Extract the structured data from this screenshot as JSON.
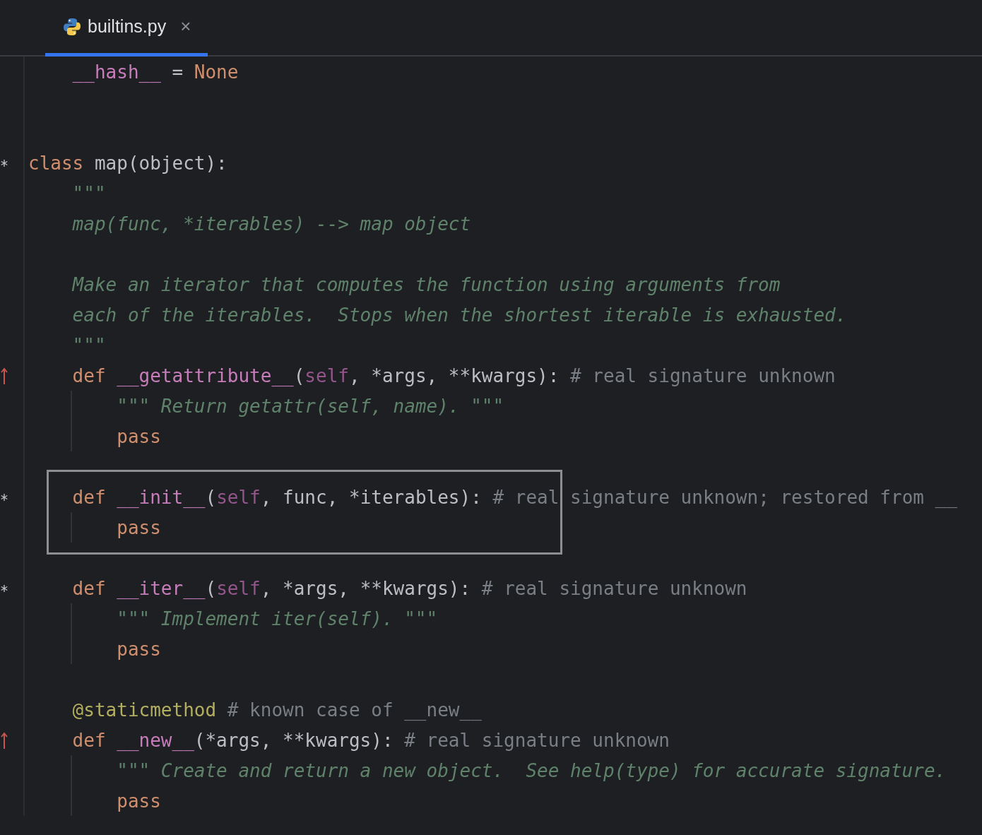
{
  "tabs": [
    {
      "label": "builtins.py",
      "close": "×",
      "selected": true
    }
  ],
  "lines": [
    {
      "kind": "code",
      "guide": false,
      "boxed": false,
      "tokens": [
        {
          "kind": "dunder",
          "text": "    __hash__"
        },
        {
          "kind": "plain",
          "text": " = "
        },
        {
          "kind": "kw",
          "text": "None"
        }
      ]
    },
    {
      "kind": "code",
      "guide": false,
      "boxed": false
    },
    {
      "kind": "code",
      "guide": false,
      "boxed": false
    },
    {
      "kind": "asterisk",
      "guide": false,
      "boxed": false,
      "tokens": [
        {
          "kind": "kw",
          "text": "class"
        },
        {
          "kind": "plain",
          "text": " map(object):"
        }
      ]
    },
    {
      "kind": "code",
      "guide": false,
      "boxed": false,
      "tokens": [
        {
          "kind": "doc",
          "text": "    \"\"\""
        }
      ]
    },
    {
      "kind": "code",
      "guide": false,
      "boxed": false,
      "tokens": [
        {
          "kind": "doc",
          "text": "    map(func, *iterables) --> map object"
        }
      ]
    },
    {
      "kind": "code",
      "guide": false,
      "boxed": false
    },
    {
      "kind": "code",
      "guide": false,
      "boxed": false,
      "tokens": [
        {
          "kind": "doc",
          "text": "    Make an iterator that computes the function using arguments from"
        }
      ]
    },
    {
      "kind": "code",
      "guide": false,
      "boxed": false,
      "tokens": [
        {
          "kind": "doc",
          "text": "    each of the iterables.  Stops when the shortest iterable is exhausted."
        }
      ]
    },
    {
      "kind": "code",
      "guide": false,
      "boxed": false,
      "tokens": [
        {
          "kind": "doc",
          "text": "    \"\"\""
        }
      ]
    },
    {
      "kind": "arrow",
      "guide": false,
      "boxed": false,
      "tokens": [
        {
          "kind": "kw",
          "text": "    def "
        },
        {
          "kind": "dunder",
          "text": "__getattribute__"
        },
        {
          "kind": "plain",
          "text": "("
        },
        {
          "kind": "self",
          "text": "self"
        },
        {
          "kind": "plain",
          "text": ", *args, **kwargs): "
        },
        {
          "kind": "comment",
          "text": "# real signature unknown"
        }
      ]
    },
    {
      "kind": "code",
      "guide": true,
      "boxed": false,
      "tokens": [
        {
          "kind": "doc",
          "text": "        \"\"\" Return getattr(self, name). \"\"\""
        }
      ]
    },
    {
      "kind": "code",
      "guide": true,
      "boxed": false,
      "tokens": [
        {
          "kind": "kw",
          "text": "        pass"
        }
      ]
    },
    {
      "kind": "code",
      "guide": false,
      "boxed": false
    },
    {
      "kind": "asterisk",
      "guide": false,
      "boxed": true,
      "tokens": [
        {
          "kind": "kw",
          "text": "    def "
        },
        {
          "kind": "dunder",
          "text": "__init__"
        },
        {
          "kind": "plain",
          "text": "("
        },
        {
          "kind": "self",
          "text": "self"
        },
        {
          "kind": "plain",
          "text": ", func, *iterables): "
        },
        {
          "kind": "comment",
          "text": "# real signature unknown; restored from __"
        }
      ]
    },
    {
      "kind": "code",
      "guide": true,
      "boxed": true,
      "tokens": [
        {
          "kind": "kw",
          "text": "        pass"
        }
      ]
    },
    {
      "kind": "code",
      "guide": false,
      "boxed": false
    },
    {
      "kind": "asterisk",
      "guide": false,
      "boxed": false,
      "tokens": [
        {
          "kind": "kw",
          "text": "    def "
        },
        {
          "kind": "dunder",
          "text": "__iter__"
        },
        {
          "kind": "plain",
          "text": "("
        },
        {
          "kind": "self",
          "text": "self"
        },
        {
          "kind": "plain",
          "text": ", *args, **kwargs): "
        },
        {
          "kind": "comment",
          "text": "# real signature unknown"
        }
      ]
    },
    {
      "kind": "code",
      "guide": true,
      "boxed": false,
      "tokens": [
        {
          "kind": "doc",
          "text": "        \"\"\" Implement iter(self). \"\"\""
        }
      ]
    },
    {
      "kind": "code",
      "guide": true,
      "boxed": false,
      "tokens": [
        {
          "kind": "kw",
          "text": "        pass"
        }
      ]
    },
    {
      "kind": "code",
      "guide": false,
      "boxed": false
    },
    {
      "kind": "code",
      "guide": false,
      "boxed": false,
      "tokens": [
        {
          "kind": "deco",
          "text": "    @staticmethod"
        },
        {
          "kind": "comment",
          "text": " # known case of __new__"
        }
      ]
    },
    {
      "kind": "arrow",
      "guide": false,
      "boxed": false,
      "tokens": [
        {
          "kind": "kw",
          "text": "    def "
        },
        {
          "kind": "dunder",
          "text": "__new__"
        },
        {
          "kind": "plain",
          "text": "(*args, **kwargs): "
        },
        {
          "kind": "comment",
          "text": "# real signature unknown"
        }
      ]
    },
    {
      "kind": "code",
      "guide": true,
      "boxed": false,
      "tokens": [
        {
          "kind": "doc",
          "text": "        \"\"\" Create and return a new object.  See help(type) for accurate signature."
        }
      ]
    },
    {
      "kind": "code",
      "guide": true,
      "boxed": false,
      "tokens": [
        {
          "kind": "kw",
          "text": "        pass"
        }
      ]
    }
  ]
}
